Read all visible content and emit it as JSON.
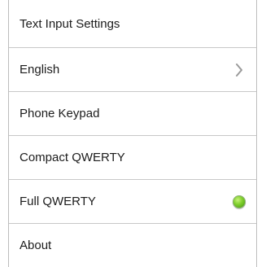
{
  "settings": {
    "title": "Text Input Settings",
    "items": [
      {
        "label": "English",
        "accessory": "chevron-right-icon"
      },
      {
        "label": "Phone Keypad",
        "accessory": ""
      },
      {
        "label": "Compact QWERTY",
        "accessory": ""
      },
      {
        "label": "Full QWERTY",
        "accessory": "selected-radio-icon",
        "selected": true
      },
      {
        "label": "About",
        "accessory": ""
      }
    ],
    "selected_color": "#6cc127"
  }
}
